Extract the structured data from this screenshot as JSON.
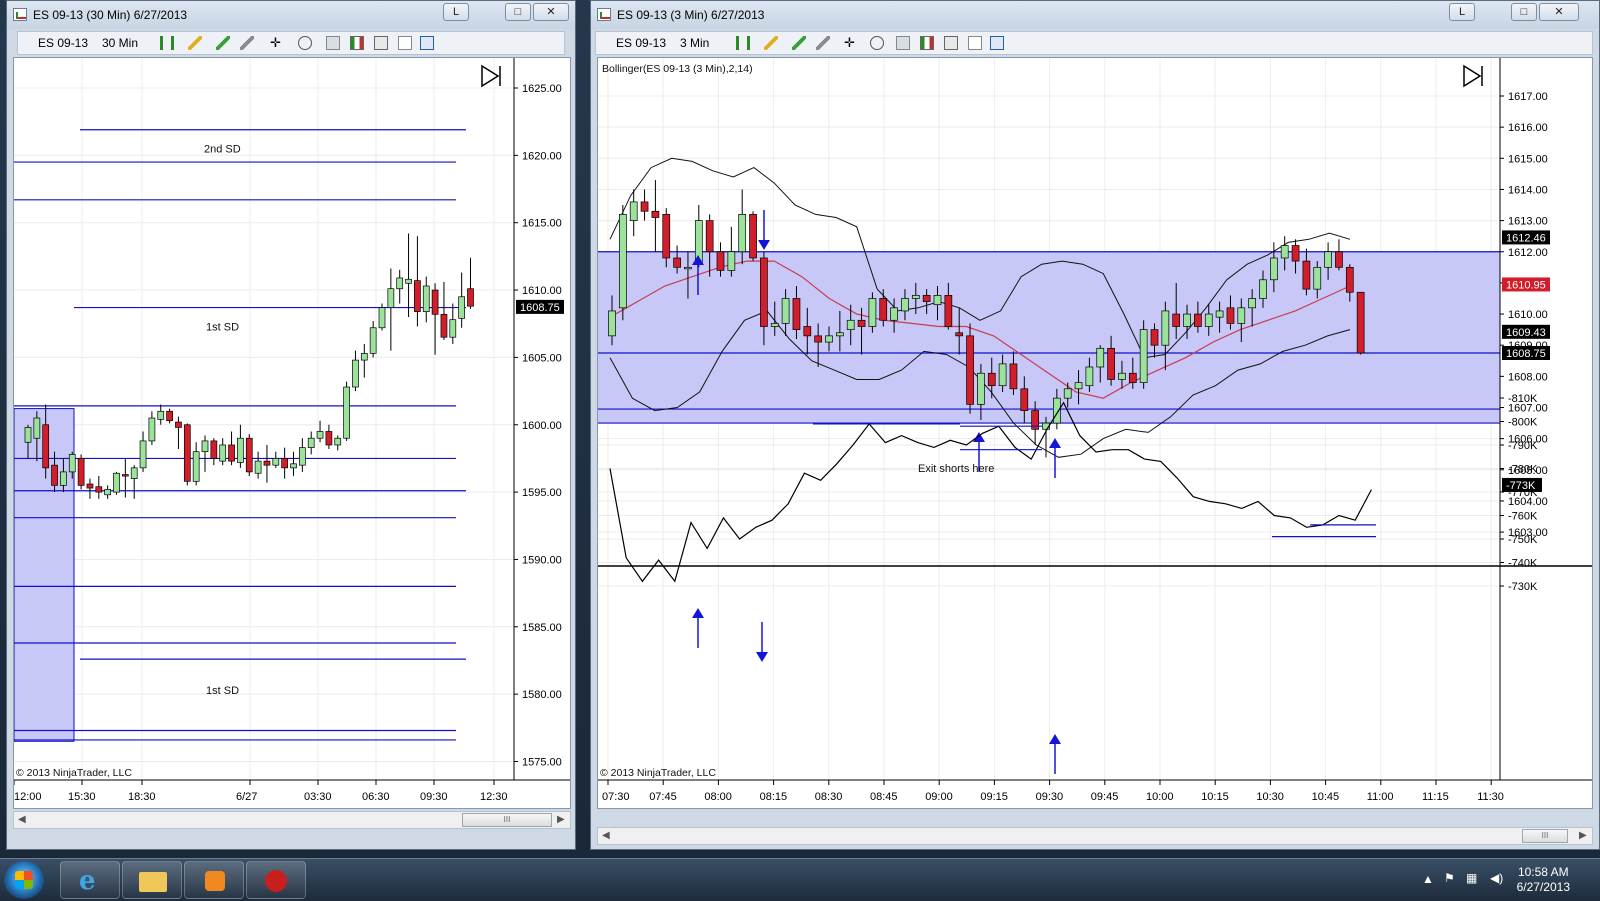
{
  "left_window": {
    "title": "ES 09-13 (30 Min)  6/27/2013",
    "title_buttons": [
      "L",
      "□",
      "✕"
    ],
    "toolbar": {
      "instrument": "ES 09-13",
      "interval": "30 Min"
    },
    "price_ticks": [
      "1625.00",
      "1620.00",
      "1615.00",
      "1610.00",
      "1605.00",
      "1600.00",
      "1595.00",
      "1590.00",
      "1585.00",
      "1580.00",
      "1575.00"
    ],
    "current_price": "1608.75",
    "time_ticks": [
      "12:00",
      "15:30",
      "18:30",
      "6/27",
      "03:30",
      "06:30",
      "09:30",
      "12:30"
    ],
    "labels": {
      "sd2_upper": "2nd SD",
      "sd1_upper": "1st SD",
      "sd1_lower": "1st SD"
    },
    "copyright": "© 2013 NinjaTrader, LLC",
    "scroll_thumb": "III"
  },
  "right_window": {
    "title": "ES 09-13 (3 Min)  6/27/2013",
    "title_buttons": [
      "L",
      "□",
      "✕"
    ],
    "toolbar": {
      "instrument": "ES 09-13",
      "interval": "3 Min"
    },
    "indicator_label": "Bollinger(ES 09-13 (3 Min),2,14)",
    "price_ticks": [
      "1617.00",
      "1616.00",
      "1615.00",
      "1614.00",
      "1613.00",
      "1612.00",
      "1611.00",
      "1610.00",
      "1609.00",
      "1608.00",
      "1607.00",
      "1606.00",
      "1605.00",
      "1604.00",
      "1603.00"
    ],
    "price_flags": [
      {
        "text": "1612.46",
        "bg": "#000000",
        "fg": "#ffffff"
      },
      {
        "text": "1610.95",
        "bg": "#d21e2b",
        "fg": "#ffffff"
      },
      {
        "text": "1609.43",
        "bg": "#000000",
        "fg": "#ffffff"
      },
      {
        "text": "1608.75",
        "bg": "#000000",
        "fg": "#ffffff"
      }
    ],
    "annotation": "Exit shorts here",
    "volume_ticks": [
      "-730K",
      "-740K",
      "-750K",
      "-760K",
      "-770K",
      "-780K",
      "-790K",
      "-800K",
      "-810K"
    ],
    "volume_flag": "-773K",
    "time_ticks": [
      "07:30",
      "07:45",
      "08:00",
      "08:15",
      "08:30",
      "08:45",
      "09:00",
      "09:15",
      "09:30",
      "09:45",
      "10:00",
      "10:15",
      "10:30",
      "10:45",
      "11:00",
      "11:15",
      "11:30"
    ],
    "copyright": "© 2013 NinjaTrader, LLC",
    "scroll_thumb": "III"
  },
  "taskbar": {
    "apps": [
      "internet-explorer",
      "file-explorer",
      "media-player",
      "ninjatrader"
    ],
    "time": "10:58 AM",
    "date": "6/27/2013"
  },
  "colors": {
    "up_candle": "#9be39b",
    "down_candle": "#d21e2b",
    "level_line": "#1010c8",
    "zone_fill": "#c8c8f8",
    "middle_band": "#c83c50"
  }
}
